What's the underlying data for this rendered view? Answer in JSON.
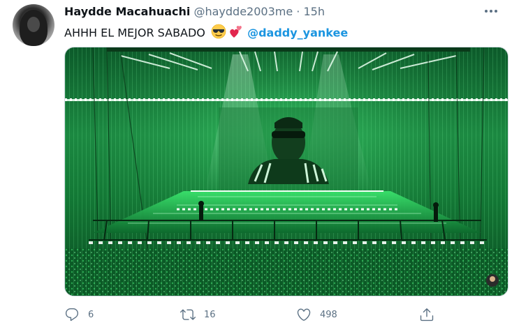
{
  "tweet": {
    "author": {
      "display_name": "Haydde Macahuachi",
      "handle": "@haydde2003me",
      "separator": "·",
      "time": "15h"
    },
    "text": {
      "body": "AHHH EL MEJOR SABADO",
      "emojis": [
        "smiling-face-with-sunglasses",
        "two-hearts"
      ],
      "mention": "@daddy_yankee"
    },
    "media": {
      "type": "photo",
      "description_icons": [
        "concert-stage"
      ]
    },
    "actions": {
      "replies": "6",
      "retweets": "16",
      "likes": "498"
    }
  },
  "colors": {
    "text": "#0f1419",
    "secondary": "#5b7083",
    "link": "#1b95e0",
    "stage_green": "#1fd35a"
  }
}
